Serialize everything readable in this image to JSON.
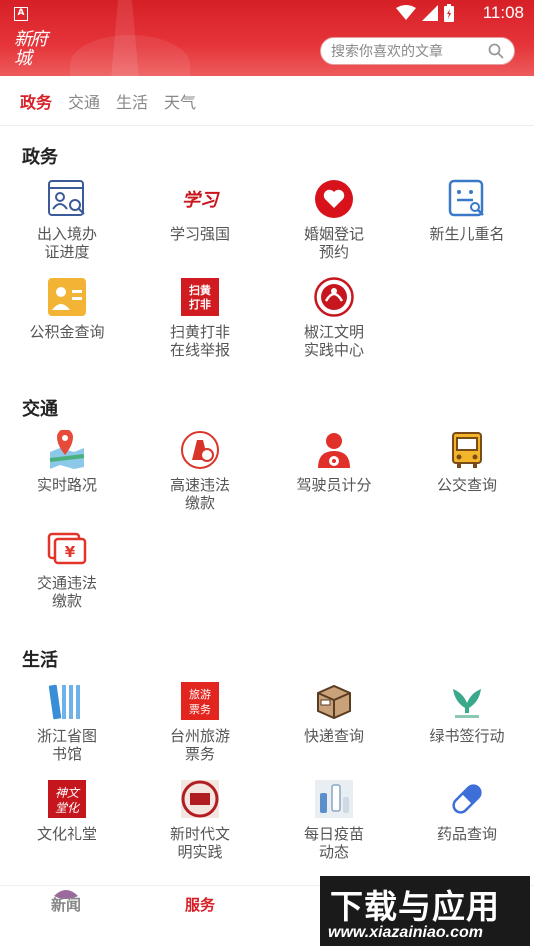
{
  "status_bar": {
    "time": "11:08"
  },
  "header": {
    "logo_text": "新府城",
    "search_placeholder": "搜索你喜欢的文章"
  },
  "tabs": [
    {
      "label": "政务",
      "active": true
    },
    {
      "label": "交通",
      "active": false
    },
    {
      "label": "生活",
      "active": false
    },
    {
      "label": "天气",
      "active": false
    }
  ],
  "sections": {
    "gov": {
      "title": "政务",
      "items": [
        {
          "label": "出入境办\n证进度",
          "icon": "id-card-search-icon"
        },
        {
          "label": "学习强国",
          "icon": "xuexi-logo-icon"
        },
        {
          "label": "婚姻登记\n预约",
          "icon": "heart-icon"
        },
        {
          "label": "新生儿重名",
          "icon": "document-search-icon"
        },
        {
          "label": "公积金查询",
          "icon": "fund-card-icon"
        },
        {
          "label": "扫黄打非\n在线举报",
          "icon": "report-icon"
        },
        {
          "label": "椒江文明\n实践中心",
          "icon": "civilization-emblem-icon"
        }
      ]
    },
    "traffic": {
      "title": "交通",
      "items": [
        {
          "label": "实时路况",
          "icon": "map-pin-icon"
        },
        {
          "label": "高速违法\n缴款",
          "icon": "highway-fine-icon"
        },
        {
          "label": "驾驶员计分",
          "icon": "driver-icon"
        },
        {
          "label": "公交查询",
          "icon": "bus-icon"
        },
        {
          "label": "交通违法\n缴款",
          "icon": "yuan-payment-icon"
        }
      ]
    },
    "life": {
      "title": "生活",
      "items": [
        {
          "label": "浙江省图\n书馆",
          "icon": "books-icon"
        },
        {
          "label": "台州旅游\n票务",
          "icon": "travel-ticket-icon"
        },
        {
          "label": "快递查询",
          "icon": "package-icon"
        },
        {
          "label": "绿书签行动",
          "icon": "green-bookmark-icon"
        },
        {
          "label": "文化礼堂",
          "icon": "culture-hall-icon"
        },
        {
          "label": "新时代文\n明实践",
          "icon": "new-era-icon"
        },
        {
          "label": "每日疫苗\n动态",
          "icon": "vaccine-icon"
        },
        {
          "label": "药品查询",
          "icon": "pill-icon"
        }
      ]
    }
  },
  "bottom_nav": [
    {
      "label": "新闻",
      "active": false
    },
    {
      "label": "服务",
      "active": true
    }
  ],
  "watermark": {
    "title": "下载与应用",
    "url": "www.xiazainiao.com"
  },
  "colors": {
    "brand_red": "#d61f26",
    "tab_gray": "#888888",
    "label_gray": "#555555"
  }
}
